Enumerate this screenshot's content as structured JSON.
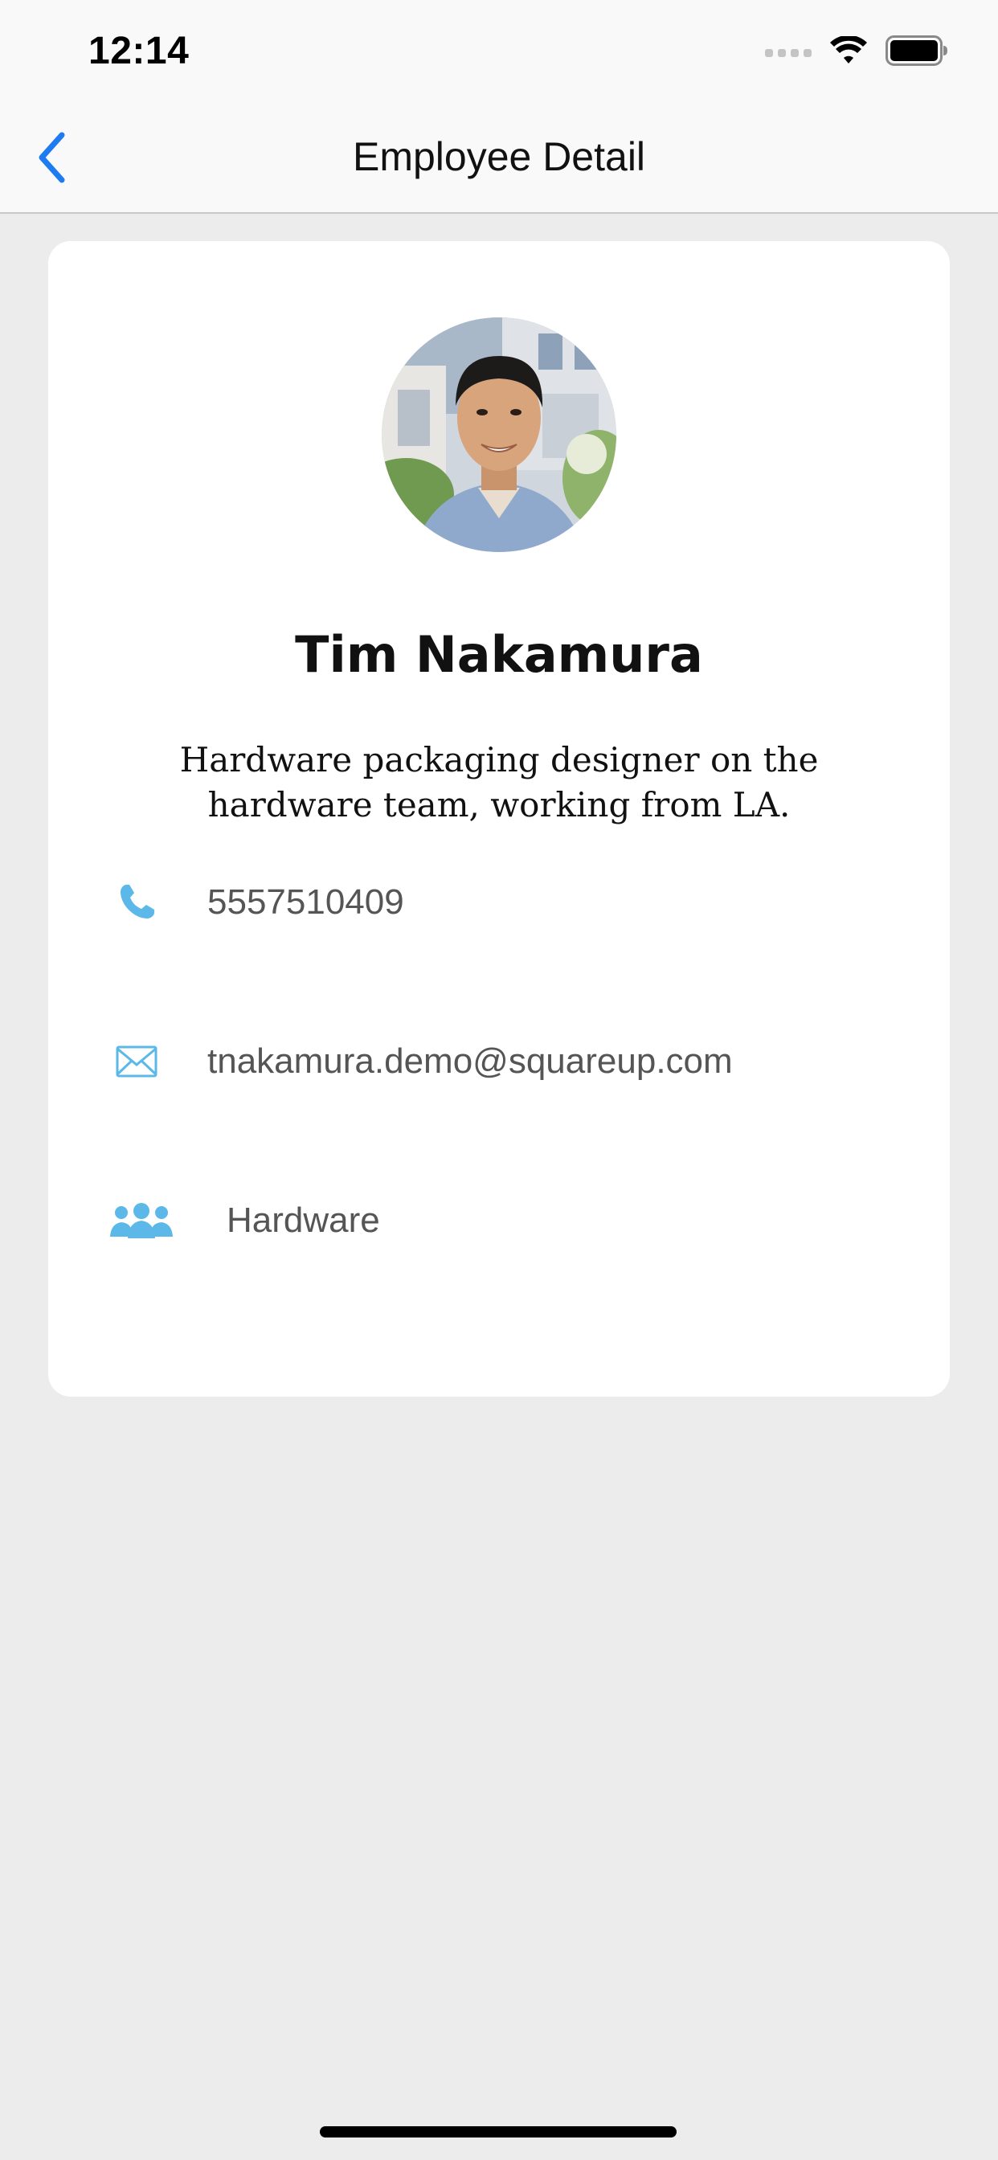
{
  "status_bar": {
    "time": "12:14"
  },
  "nav": {
    "title": "Employee Detail",
    "back_icon": "chevron-left-icon"
  },
  "employee": {
    "name": "Tim Nakamura",
    "bio": "Hardware packaging designer on the hardware team, working from LA.",
    "phone": "5557510409",
    "email": "tnakamura.demo@squareup.com",
    "team": "Hardware"
  },
  "icons": {
    "phone": "phone-icon",
    "email": "envelope-icon",
    "team": "people-group-icon"
  },
  "colors": {
    "accent": "#1f7cf0",
    "icon_blue": "#5bb8e8",
    "card_bg": "#ffffff",
    "page_bg": "#ececec"
  }
}
